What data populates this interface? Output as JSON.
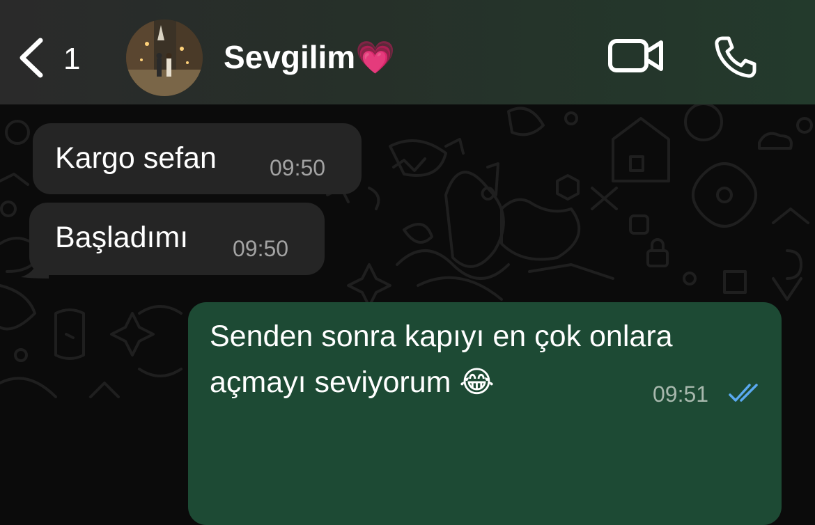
{
  "header": {
    "unread_count": "1",
    "contact_name": "Sevgilim💗",
    "back_icon": "chevron-left-icon",
    "video_icon": "video-camera-icon",
    "call_icon": "phone-icon"
  },
  "messages": [
    {
      "direction": "incoming",
      "text": "Kargo sefan",
      "time": "09:50"
    },
    {
      "direction": "incoming",
      "text": "Başladımı",
      "time": "09:50"
    },
    {
      "direction": "outgoing",
      "line1": "Senden sonra kapıyı en çok onlara",
      "line2": "açmayı seviyorum 😂",
      "time": "09:51",
      "status": "read"
    }
  ],
  "colors": {
    "header_bg": "#263029",
    "chat_bg": "#0b0b0b",
    "incoming_bubble": "#252525",
    "outgoing_bubble": "#1d4a34",
    "read_ticks": "#5aa9f0"
  }
}
